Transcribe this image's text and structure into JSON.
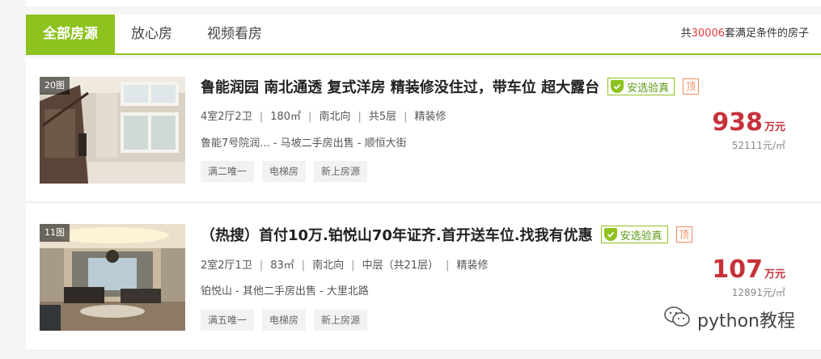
{
  "tabs": [
    {
      "label": "全部房源",
      "active": true
    },
    {
      "label": "放心房",
      "active": false
    },
    {
      "label": "视频看房",
      "active": false
    }
  ],
  "result_count": {
    "prefix": "共",
    "number": "30006",
    "suffix": "套满足条件的房子"
  },
  "listings": [
    {
      "pic_count": "20图",
      "title": "鲁能润园 南北通透 复式洋房 精装修没住过，带车位 超大露台",
      "verify_label": "安选验真",
      "top_label": "顶",
      "info": [
        "4室2厅2卫",
        "180㎡",
        "南北向",
        "共5层",
        "精装修"
      ],
      "address": "鲁能7号院润... - 马坡二手房出售 - 顺恒大街",
      "tags": [
        "满二唯一",
        "电梯房",
        "新上房源"
      ],
      "total_price": "938",
      "total_unit": "万元",
      "unit_price": "52111元/㎡"
    },
    {
      "pic_count": "11图",
      "title": "（热搜）首付10万.铂悦山70年证齐.首开送车位.找我有优惠",
      "verify_label": "安选验真",
      "top_label": "顶",
      "info": [
        "2室2厅1卫",
        "83㎡",
        "南北向",
        "中层（共21层）",
        "精装修"
      ],
      "address": "铂悦山 - 其他二手房出售 - 大里北路",
      "tags": [
        "满五唯一",
        "电梯房",
        "新上房源"
      ],
      "total_price": "107",
      "total_unit": "万元",
      "unit_price": "12891元/㎡"
    }
  ],
  "watermark": {
    "text": "python教程",
    "icon": "wechat-icon"
  },
  "colors": {
    "accent": "#8dc21f",
    "price": "#c6323a",
    "count": "#e4393c",
    "top_tag": "#f08a5d"
  }
}
